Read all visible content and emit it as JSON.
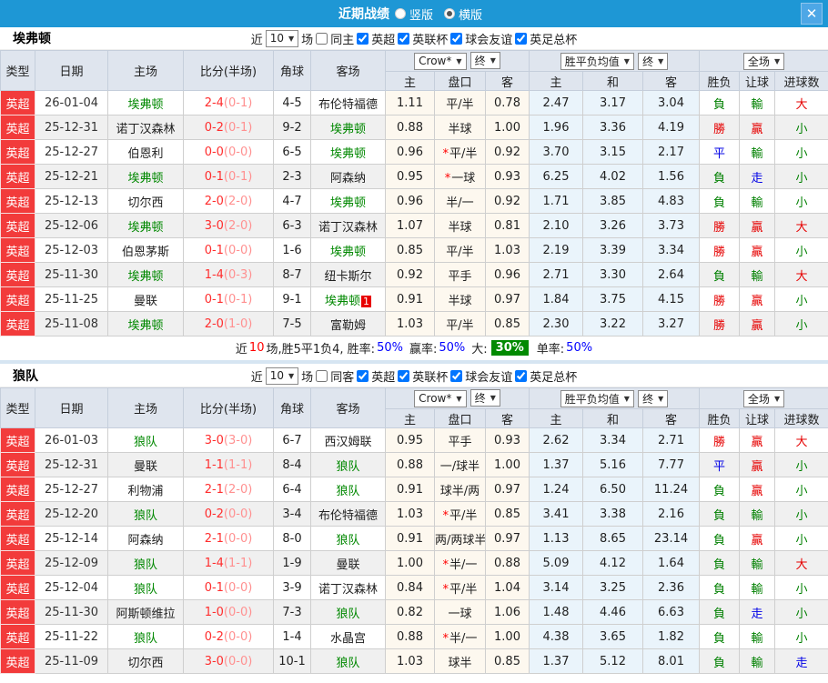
{
  "title_bar": {
    "title": "近期战绩",
    "radio_vertical": "竖版",
    "radio_horizontal": "横版"
  },
  "labels": {
    "recent": "近",
    "games": "场"
  },
  "header": {
    "type": "类型",
    "date": "日期",
    "home": "主场",
    "score": "比分(半场)",
    "corner": "角球",
    "away": "客场",
    "odds_source": "Crow*",
    "final": "终",
    "avg": "胜平负均值",
    "full": "全场",
    "sub": [
      "主",
      "盘口",
      "客",
      "主",
      "和",
      "客",
      "胜负",
      "让球",
      "进球数"
    ]
  },
  "colors": {
    "title_bar": "#1e97d5",
    "league_badge": "#f23b3b",
    "focus_team": "#008800",
    "win": "#e60000",
    "lose": "#008000",
    "draw_go": "#0000e6",
    "score_ft": "#ff2d2d",
    "score_ht": "#ff9090",
    "big_rate_bg": "#018a01"
  },
  "teams": [
    {
      "name": "埃弗顿",
      "count": "10",
      "same_label": "同主",
      "leagues": [
        "英超",
        "英联杯",
        "球会友谊",
        "英足总杯"
      ],
      "summary": {
        "prefix": "近",
        "count": "10",
        "middle": "场,胜5平1负4, 胜率:",
        "win_rate": "50%",
        "label2": "赢率:",
        "asian_rate": "50%",
        "label3": "大:",
        "big_rate": "30%",
        "label4": "单率:",
        "odd_rate": "50%"
      },
      "rows": [
        {
          "league": "英超",
          "date": "26-01-04",
          "home": "埃弗顿",
          "hf": true,
          "ft": "2-4",
          "ht": "(0-1)",
          "corner": "4-5",
          "away": "布伦特福德",
          "af": false,
          "oh": "1.11",
          "hdp": "平/半",
          "star": false,
          "oa": "0.78",
          "ah": "2.47",
          "ad": "3.17",
          "aa": "3.04",
          "res": [
            [
              "負",
              "g"
            ],
            [
              "輸",
              "g"
            ],
            [
              "大",
              "r"
            ]
          ]
        },
        {
          "league": "英超",
          "date": "25-12-31",
          "home": "诺丁汉森林",
          "hf": false,
          "ft": "0-2",
          "ht": "(0-1)",
          "corner": "9-2",
          "away": "埃弗顿",
          "af": true,
          "oh": "0.88",
          "hdp": "半球",
          "star": false,
          "oa": "1.00",
          "ah": "1.96",
          "ad": "3.36",
          "aa": "4.19",
          "res": [
            [
              "勝",
              "r"
            ],
            [
              "贏",
              "r"
            ],
            [
              "小",
              "g"
            ]
          ]
        },
        {
          "league": "英超",
          "date": "25-12-27",
          "home": "伯恩利",
          "hf": false,
          "ft": "0-0",
          "ht": "(0-0)",
          "corner": "6-5",
          "away": "埃弗顿",
          "af": true,
          "oh": "0.96",
          "hdp": "平/半",
          "star": true,
          "oa": "0.92",
          "ah": "3.70",
          "ad": "3.15",
          "aa": "2.17",
          "res": [
            [
              "平",
              "b"
            ],
            [
              "輸",
              "g"
            ],
            [
              "小",
              "g"
            ]
          ]
        },
        {
          "league": "英超",
          "date": "25-12-21",
          "home": "埃弗顿",
          "hf": true,
          "ft": "0-1",
          "ht": "(0-1)",
          "corner": "2-3",
          "away": "阿森纳",
          "af": false,
          "oh": "0.95",
          "hdp": "一球",
          "star": true,
          "oa": "0.93",
          "ah": "6.25",
          "ad": "4.02",
          "aa": "1.56",
          "res": [
            [
              "負",
              "g"
            ],
            [
              "走",
              "b"
            ],
            [
              "小",
              "g"
            ]
          ]
        },
        {
          "league": "英超",
          "date": "25-12-13",
          "home": "切尔西",
          "hf": false,
          "ft": "2-0",
          "ht": "(2-0)",
          "corner": "4-7",
          "away": "埃弗顿",
          "af": true,
          "oh": "0.96",
          "hdp": "半/一",
          "star": false,
          "oa": "0.92",
          "ah": "1.71",
          "ad": "3.85",
          "aa": "4.83",
          "res": [
            [
              "負",
              "g"
            ],
            [
              "輸",
              "g"
            ],
            [
              "小",
              "g"
            ]
          ]
        },
        {
          "league": "英超",
          "date": "25-12-06",
          "home": "埃弗顿",
          "hf": true,
          "ft": "3-0",
          "ht": "(2-0)",
          "corner": "6-3",
          "away": "诺丁汉森林",
          "af": false,
          "oh": "1.07",
          "hdp": "半球",
          "star": false,
          "oa": "0.81",
          "ah": "2.10",
          "ad": "3.26",
          "aa": "3.73",
          "res": [
            [
              "勝",
              "r"
            ],
            [
              "贏",
              "r"
            ],
            [
              "大",
              "r"
            ]
          ]
        },
        {
          "league": "英超",
          "date": "25-12-03",
          "home": "伯恩茅斯",
          "hf": false,
          "ft": "0-1",
          "ht": "(0-0)",
          "corner": "1-6",
          "away": "埃弗顿",
          "af": true,
          "oh": "0.85",
          "hdp": "平/半",
          "star": false,
          "oa": "1.03",
          "ah": "2.19",
          "ad": "3.39",
          "aa": "3.34",
          "res": [
            [
              "勝",
              "r"
            ],
            [
              "贏",
              "r"
            ],
            [
              "小",
              "g"
            ]
          ]
        },
        {
          "league": "英超",
          "date": "25-11-30",
          "home": "埃弗顿",
          "hf": true,
          "ft": "1-4",
          "ht": "(0-3)",
          "corner": "8-7",
          "away": "纽卡斯尔",
          "af": false,
          "oh": "0.92",
          "hdp": "平手",
          "star": false,
          "oa": "0.96",
          "ah": "2.71",
          "ad": "3.30",
          "aa": "2.64",
          "res": [
            [
              "負",
              "g"
            ],
            [
              "輸",
              "g"
            ],
            [
              "大",
              "r"
            ]
          ]
        },
        {
          "league": "英超",
          "date": "25-11-25",
          "home": "曼联",
          "hf": false,
          "ft": "0-1",
          "ht": "(0-1)",
          "corner": "9-1",
          "away": "埃弗顿",
          "af": true,
          "badge": "1",
          "oh": "0.91",
          "hdp": "半球",
          "star": false,
          "oa": "0.97",
          "ah": "1.84",
          "ad": "3.75",
          "aa": "4.15",
          "res": [
            [
              "勝",
              "r"
            ],
            [
              "贏",
              "r"
            ],
            [
              "小",
              "g"
            ]
          ]
        },
        {
          "league": "英超",
          "date": "25-11-08",
          "home": "埃弗顿",
          "hf": true,
          "ft": "2-0",
          "ht": "(1-0)",
          "corner": "7-5",
          "away": "富勒姆",
          "af": false,
          "oh": "1.03",
          "hdp": "平/半",
          "star": false,
          "oa": "0.85",
          "ah": "2.30",
          "ad": "3.22",
          "aa": "3.27",
          "res": [
            [
              "勝",
              "r"
            ],
            [
              "贏",
              "r"
            ],
            [
              "小",
              "g"
            ]
          ]
        }
      ]
    },
    {
      "name": "狼队",
      "count": "10",
      "same_label": "同客",
      "leagues": [
        "英超",
        "英联杯",
        "球会友谊",
        "英足总杯"
      ],
      "rows": [
        {
          "league": "英超",
          "date": "26-01-03",
          "home": "狼队",
          "hf": true,
          "ft": "3-0",
          "ht": "(3-0)",
          "corner": "6-7",
          "away": "西汉姆联",
          "af": false,
          "oh": "0.95",
          "hdp": "平手",
          "star": false,
          "oa": "0.93",
          "ah": "2.62",
          "ad": "3.34",
          "aa": "2.71",
          "res": [
            [
              "勝",
              "r"
            ],
            [
              "贏",
              "r"
            ],
            [
              "大",
              "r"
            ]
          ]
        },
        {
          "league": "英超",
          "date": "25-12-31",
          "home": "曼联",
          "hf": false,
          "ft": "1-1",
          "ht": "(1-1)",
          "corner": "8-4",
          "away": "狼队",
          "af": true,
          "oh": "0.88",
          "hdp": "一/球半",
          "star": false,
          "oa": "1.00",
          "ah": "1.37",
          "ad": "5.16",
          "aa": "7.77",
          "res": [
            [
              "平",
              "b"
            ],
            [
              "贏",
              "r"
            ],
            [
              "小",
              "g"
            ]
          ]
        },
        {
          "league": "英超",
          "date": "25-12-27",
          "home": "利物浦",
          "hf": false,
          "ft": "2-1",
          "ht": "(2-0)",
          "corner": "6-4",
          "away": "狼队",
          "af": true,
          "oh": "0.91",
          "hdp": "球半/两",
          "star": false,
          "oa": "0.97",
          "ah": "1.24",
          "ad": "6.50",
          "aa": "11.24",
          "res": [
            [
              "負",
              "g"
            ],
            [
              "贏",
              "r"
            ],
            [
              "小",
              "g"
            ]
          ]
        },
        {
          "league": "英超",
          "date": "25-12-20",
          "home": "狼队",
          "hf": true,
          "ft": "0-2",
          "ht": "(0-0)",
          "corner": "3-4",
          "away": "布伦特福德",
          "af": false,
          "oh": "1.03",
          "hdp": "平/半",
          "star": true,
          "oa": "0.85",
          "ah": "3.41",
          "ad": "3.38",
          "aa": "2.16",
          "res": [
            [
              "負",
              "g"
            ],
            [
              "輸",
              "g"
            ],
            [
              "小",
              "g"
            ]
          ]
        },
        {
          "league": "英超",
          "date": "25-12-14",
          "home": "阿森纳",
          "hf": false,
          "ft": "2-1",
          "ht": "(0-0)",
          "corner": "8-0",
          "away": "狼队",
          "af": true,
          "oh": "0.91",
          "hdp": "两/两球半",
          "star": false,
          "oa": "0.97",
          "ah": "1.13",
          "ad": "8.65",
          "aa": "23.14",
          "res": [
            [
              "負",
              "g"
            ],
            [
              "贏",
              "r"
            ],
            [
              "小",
              "g"
            ]
          ]
        },
        {
          "league": "英超",
          "date": "25-12-09",
          "home": "狼队",
          "hf": true,
          "ft": "1-4",
          "ht": "(1-1)",
          "corner": "1-9",
          "away": "曼联",
          "af": false,
          "oh": "1.00",
          "hdp": "半/一",
          "star": true,
          "oa": "0.88",
          "ah": "5.09",
          "ad": "4.12",
          "aa": "1.64",
          "res": [
            [
              "負",
              "g"
            ],
            [
              "輸",
              "g"
            ],
            [
              "大",
              "r"
            ]
          ]
        },
        {
          "league": "英超",
          "date": "25-12-04",
          "home": "狼队",
          "hf": true,
          "ft": "0-1",
          "ht": "(0-0)",
          "corner": "3-9",
          "away": "诺丁汉森林",
          "af": false,
          "oh": "0.84",
          "hdp": "平/半",
          "star": true,
          "oa": "1.04",
          "ah": "3.14",
          "ad": "3.25",
          "aa": "2.36",
          "res": [
            [
              "負",
              "g"
            ],
            [
              "輸",
              "g"
            ],
            [
              "小",
              "g"
            ]
          ]
        },
        {
          "league": "英超",
          "date": "25-11-30",
          "home": "阿斯顿维拉",
          "hf": false,
          "ft": "1-0",
          "ht": "(0-0)",
          "corner": "7-3",
          "away": "狼队",
          "af": true,
          "oh": "0.82",
          "hdp": "一球",
          "star": false,
          "oa": "1.06",
          "ah": "1.48",
          "ad": "4.46",
          "aa": "6.63",
          "res": [
            [
              "負",
              "g"
            ],
            [
              "走",
              "b"
            ],
            [
              "小",
              "g"
            ]
          ]
        },
        {
          "league": "英超",
          "date": "25-11-22",
          "home": "狼队",
          "hf": true,
          "ft": "0-2",
          "ht": "(0-0)",
          "corner": "1-4",
          "away": "水晶宫",
          "af": false,
          "oh": "0.88",
          "hdp": "半/一",
          "star": true,
          "oa": "1.00",
          "ah": "4.38",
          "ad": "3.65",
          "aa": "1.82",
          "res": [
            [
              "負",
              "g"
            ],
            [
              "輸",
              "g"
            ],
            [
              "小",
              "g"
            ]
          ]
        },
        {
          "league": "英超",
          "date": "25-11-09",
          "home": "切尔西",
          "hf": false,
          "ft": "3-0",
          "ht": "(0-0)",
          "corner": "10-1",
          "away": "狼队",
          "af": true,
          "oh": "1.03",
          "hdp": "球半",
          "star": false,
          "oa": "0.85",
          "ah": "1.37",
          "ad": "5.12",
          "aa": "8.01",
          "res": [
            [
              "負",
              "g"
            ],
            [
              "輸",
              "g"
            ],
            [
              "走",
              "b"
            ]
          ]
        }
      ]
    }
  ]
}
